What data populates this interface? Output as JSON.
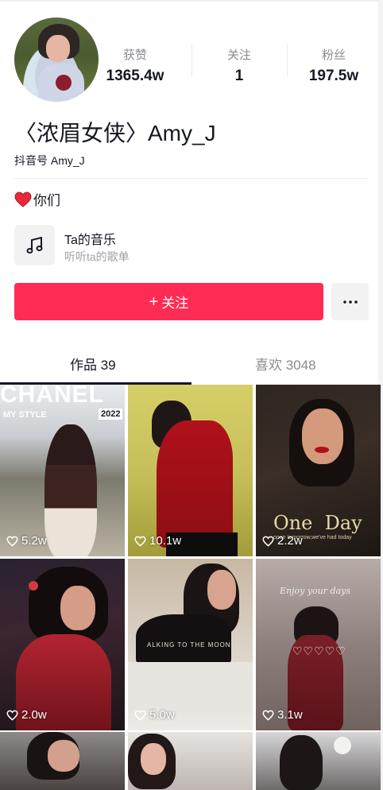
{
  "profile": {
    "name": "〈浓眉女侠〉Amy_J",
    "douyin_id": "抖音号 Amy_J",
    "stats": [
      {
        "label": "获赞",
        "value": "1365.4w"
      },
      {
        "label": "关注",
        "value": "1"
      },
      {
        "label": "粉丝",
        "value": "197.5w"
      }
    ],
    "bio": "你们"
  },
  "music": {
    "title": "Ta的音乐",
    "subtitle": "听听ta的歌单"
  },
  "actions": {
    "follow_label": "关注",
    "follow_plus": "+",
    "more_label": "···"
  },
  "tabs": [
    {
      "label": "作品 39",
      "active": true
    },
    {
      "label": "喜欢 3048",
      "active": false
    }
  ],
  "videos": [
    {
      "likes": "5.2w",
      "overlay_title": "CHANEL",
      "overlay_sub": "MY STYLE",
      "overlay_badge": "2022"
    },
    {
      "likes": "10.1w"
    },
    {
      "likes": "2.2w",
      "overlay_title": "One  Day",
      "overlay_sub": "open tomorrow,we've had today"
    },
    {
      "likes": "2.0w"
    },
    {
      "likes": "5.0w",
      "overlay_sub": "ALKING TO THE MOON"
    },
    {
      "likes": "3.1w",
      "overlay_sub": "Enjoy your days",
      "overlay_hearts": "♡♡♡♡♡"
    },
    {},
    {},
    {}
  ],
  "colors": {
    "accent": "#fe2c55",
    "text": "#161823",
    "muted": "#8a8b91"
  },
  "icons": {
    "heart": "heart-icon",
    "music": "music-note-icon",
    "more": "more-dots-icon",
    "plus": "plus-icon"
  }
}
